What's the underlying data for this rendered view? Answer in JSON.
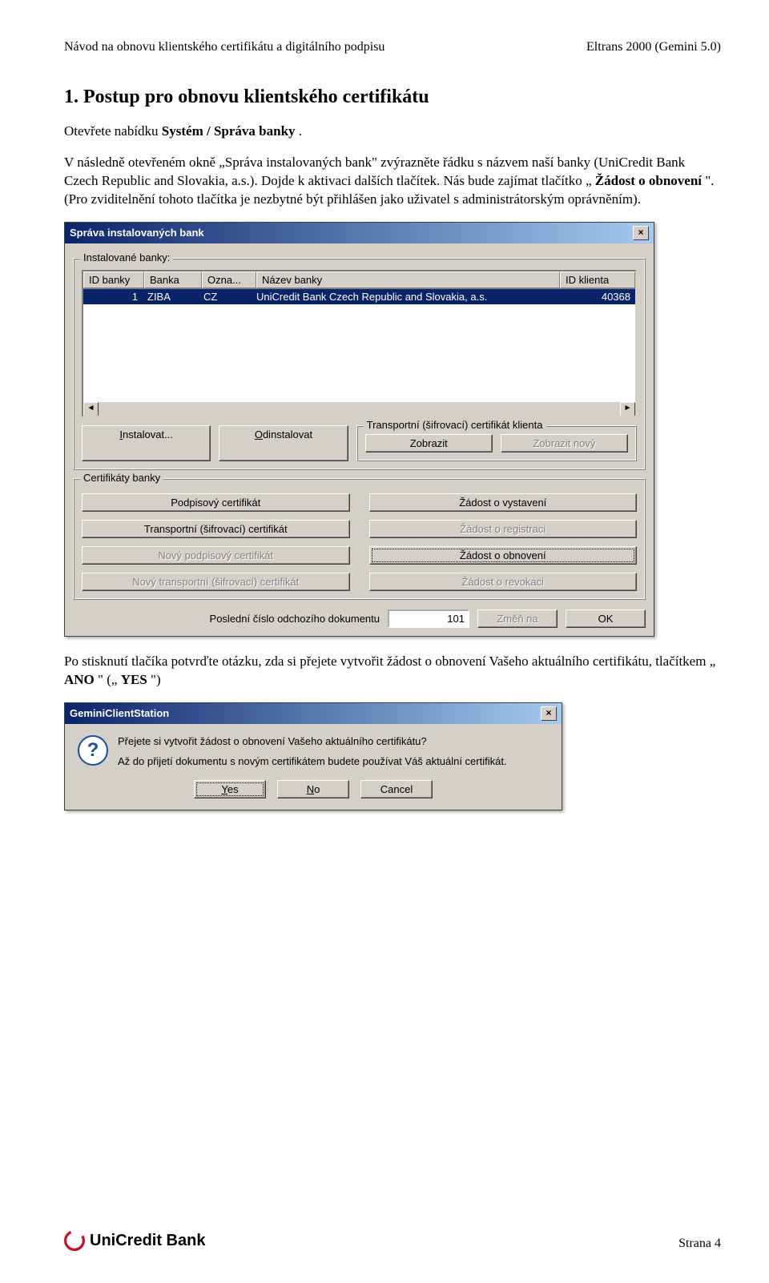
{
  "header": {
    "left": "Návod na obnovu klientského certifikátu a digitálního podpisu",
    "right": "Eltrans 2000 (Gemini 5.0)"
  },
  "section_title": "1. Postup pro obnovu klientského certifikátu",
  "para1_a": "Otevřete nabídku ",
  "para1_b": "Systém / Správa banky",
  "para1_c": ".",
  "para2_a": "V následně otevřeném okně „Správa instalovaných bank\" zvýrazněte řádku s názvem naší banky (UniCredit Bank Czech Republic and Slovakia, a.s.). Dojde k aktivaci dalších tlačítek. Nás bude zajímat tlačítko „",
  "para2_b": "Žádost o obnovení",
  "para2_c": "\". (Pro zviditelnění tohoto tlačítka je nezbytné být přihlášen jako uživatel s administrátorským oprávněním).",
  "dlg1": {
    "title": "Správa instalovaných bank",
    "group_top": "Instalované banky:",
    "cols": {
      "id": "ID banky",
      "bank": "Banka",
      "ozna": "Ozna...",
      "name": "Název banky",
      "client": "ID klienta"
    },
    "row": {
      "id": "1",
      "bank": "ZIBA",
      "ozna": "CZ",
      "name": "UniCredit Bank Czech Republic and Slovakia, a.s.",
      "client": "40368"
    },
    "btn_install": "Instalovat...",
    "btn_uninstall": "Odinstalovat",
    "group_right": "Transportní (šifrovací) certifikát klienta",
    "btn_show": "Zobrazit",
    "btn_show_new": "Zobrazit nový",
    "group_cert": "Certifikáty banky",
    "btn_sign": "Podpisový certifikát",
    "btn_req_issue": "Žádost o vystavení",
    "btn_trans": "Transportní (šifrovací) certifikát",
    "btn_req_reg": "Žádost o registraci",
    "btn_new_sign": "Nový podpisový certifikát",
    "btn_req_renew": "Žádost o obnovení",
    "btn_new_trans": "Nový transportní (šifrovací) certifikát",
    "btn_req_revoke": "Žádost o revokaci",
    "lbl_last": "Poslední číslo odchozího dokumentu",
    "val_last": "101",
    "btn_change": "Změň na",
    "btn_ok": "OK"
  },
  "para3_a": "Po stisknutí tlačíka potvrďte otázku, zda si přejete vytvořit žádost o obnovení Vašeho aktuálního certifikátu, tlačítkem „",
  "para3_b": "ANO",
  "para3_c": "\" („",
  "para3_d": "YES",
  "para3_e": "\")",
  "dlg2": {
    "title": "GeminiClientStation",
    "line1": "Přejete si vytvořit žádost o obnovení Vašeho aktuálního certifikátu?",
    "line2": "Až do přijetí dokumentu s novým certifikátem budete používat Váš aktuální certifikát.",
    "yes": "Yes",
    "no": "No",
    "cancel": "Cancel"
  },
  "footer": {
    "brand": "UniCredit Bank",
    "page": "Strana 4"
  }
}
